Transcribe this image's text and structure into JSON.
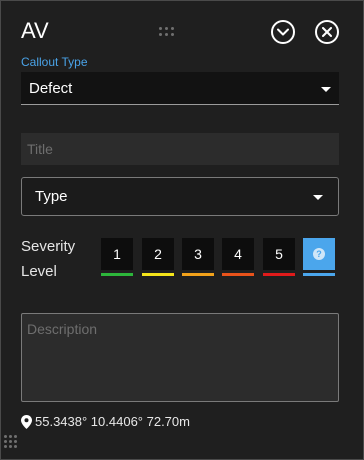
{
  "header": {
    "title": "AV"
  },
  "callout": {
    "label": "Callout Type",
    "value": "Defect"
  },
  "title_field": {
    "placeholder": "Title"
  },
  "type_field": {
    "value": "Type"
  },
  "severity": {
    "label_line1": "Severity",
    "label_line2": "Level",
    "levels": [
      {
        "label": "1",
        "color": "#2db63b"
      },
      {
        "label": "2",
        "color": "#f5e51b"
      },
      {
        "label": "3",
        "color": "#f2a21b"
      },
      {
        "label": "4",
        "color": "#e9531b"
      },
      {
        "label": "5",
        "color": "#e01b1b"
      }
    ],
    "help_icon": "question-circle-icon",
    "help_color": "#4ba6ec"
  },
  "description": {
    "placeholder": "Description"
  },
  "location": {
    "icon": "map-pin-icon",
    "text": "55.3438° 10.4406° 72.70m"
  },
  "colors": {
    "accent": "#4aa3e8",
    "panel_bg": "#1f1f1f"
  }
}
